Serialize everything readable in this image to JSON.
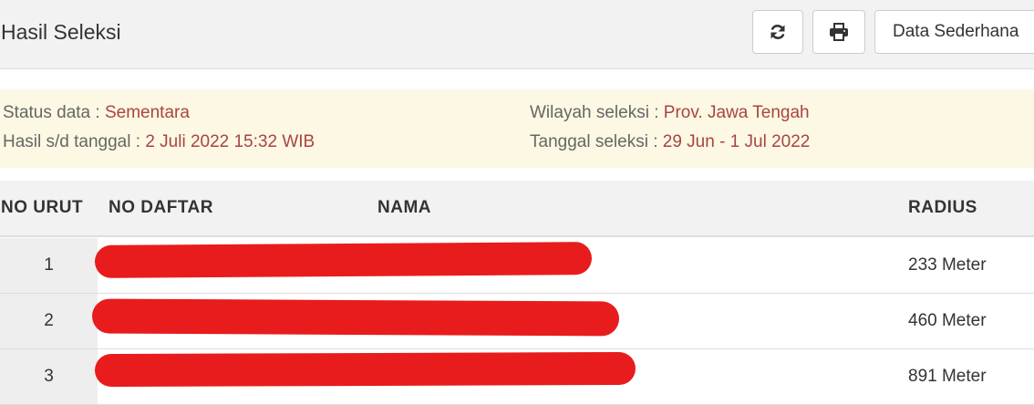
{
  "header": {
    "title": "Hasil Seleksi",
    "refresh_icon": "refresh-icon",
    "print_icon": "print-icon",
    "dropdown_label": "Data Sederhana"
  },
  "info": {
    "status_label": "Status data : ",
    "status_value": "Sementara",
    "hasil_label": "Hasil s/d tanggal : ",
    "hasil_value": "2 Juli 2022 15:32 WIB",
    "wilayah_label": "Wilayah seleksi : ",
    "wilayah_value": "Prov. Jawa Tengah",
    "tanggal_label": "Tanggal seleksi : ",
    "tanggal_value": "29 Jun - 1 Jul 2022"
  },
  "table": {
    "columns": {
      "no_urut": "NO URUT",
      "no_daftar": "NO DAFTAR",
      "nama": "NAMA",
      "radius": "RADIUS"
    },
    "rows": [
      {
        "no": "1",
        "radius": "233 Meter"
      },
      {
        "no": "2",
        "radius": "460 Meter"
      },
      {
        "no": "3",
        "radius": "891 Meter"
      }
    ]
  },
  "colors": {
    "header_bg": "#f2f2f2",
    "info_bg": "#fcf8e3",
    "value_text": "#a94442",
    "redaction": "#e81c1c"
  }
}
